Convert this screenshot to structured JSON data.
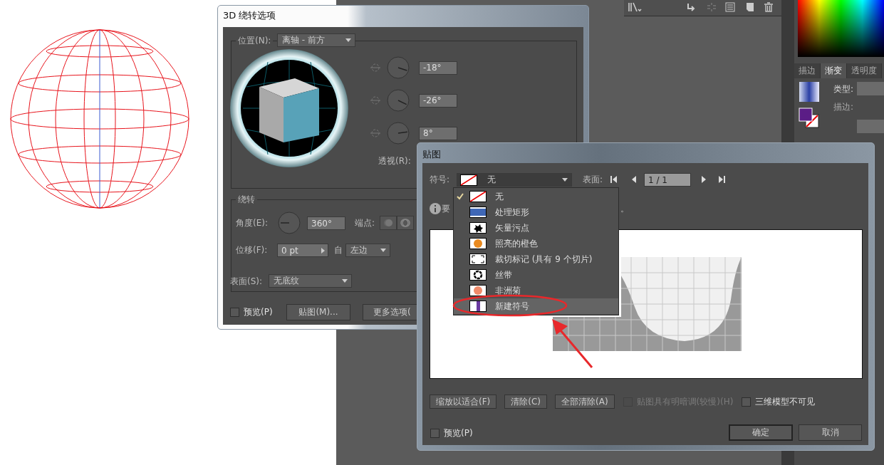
{
  "panel": {
    "tabs": [
      {
        "label": "描边",
        "selected": false
      },
      {
        "label": "渐变",
        "selected": true
      },
      {
        "label": "透明度",
        "selected": false
      }
    ],
    "type_label": "类型:",
    "stroke_label": "描边:"
  },
  "revolve_dialog": {
    "title": "3D 绕转选项",
    "position_label": "位置(N):",
    "position_value": "离轴 - 前方",
    "rotations": [
      {
        "value": "-18°"
      },
      {
        "value": "-26°"
      },
      {
        "value": "8°"
      }
    ],
    "perspective_label": "透视(R):",
    "revolve_group": "绕转",
    "angle_label": "角度(E):",
    "angle_value": "360°",
    "cap_label": "端点:",
    "offset_label": "位移(F):",
    "offset_value": "0 pt",
    "from_label": "自",
    "from_value": "左边",
    "surface_label": "表面(S):",
    "surface_value": "无底纹",
    "preview": {
      "label": "预览(P)",
      "checked": false
    },
    "map_button": "贴图(M)...",
    "more_button": "更多选项("
  },
  "map_dialog": {
    "title": "贴图",
    "symbol_label": "符号:",
    "symbol_value": "无",
    "surface_label": "表面:",
    "surface_value": "1 / 1",
    "info_text": "要",
    "info_tail": "。",
    "symbols": [
      {
        "label": "无",
        "kind": "none",
        "selected": true,
        "highlighted": false
      },
      {
        "label": "处理矩形",
        "kind": "rect",
        "selected": false,
        "highlighted": false
      },
      {
        "label": "矢量污点",
        "kind": "splat",
        "selected": false,
        "highlighted": false
      },
      {
        "label": "照亮的橙色",
        "kind": "orange",
        "selected": false,
        "highlighted": false
      },
      {
        "label": "裁切标记 (具有 9 个切片)",
        "kind": "crop",
        "selected": false,
        "highlighted": false
      },
      {
        "label": "丝带",
        "kind": "ribbon",
        "selected": false,
        "highlighted": false
      },
      {
        "label": "非洲菊",
        "kind": "flower",
        "selected": false,
        "highlighted": false
      },
      {
        "label": "新建符号",
        "kind": "purple",
        "selected": false,
        "highlighted": true
      }
    ],
    "buttons": [
      "缩放以适合(F)",
      "清除(C)",
      "全部清除(A)"
    ],
    "shade": {
      "label": "贴图具有明暗调(较慢)(H)",
      "checked": false,
      "disabled": true
    },
    "invisible": {
      "label": "三维模型不可见",
      "checked": false,
      "disabled": false
    },
    "preview": {
      "label": "预览(P)",
      "checked": false
    },
    "ok": "确定",
    "cancel": "取消"
  }
}
